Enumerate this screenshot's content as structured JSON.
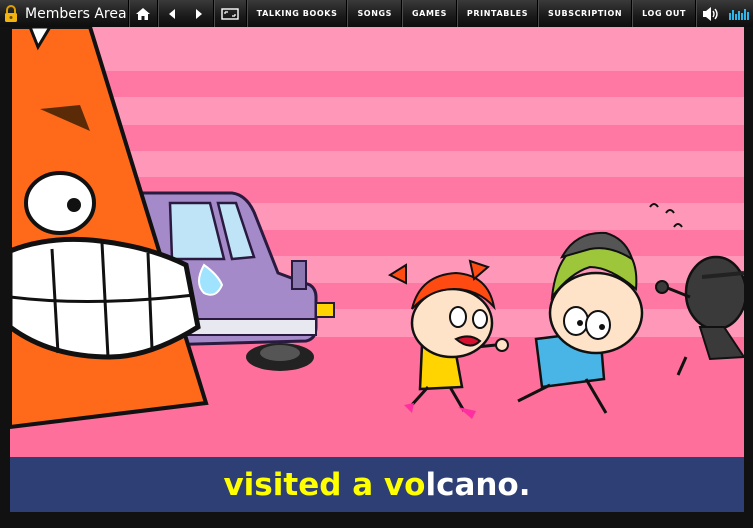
{
  "header": {
    "title": "Members Area",
    "nav": [
      "TALKING BOOKS",
      "SONGS",
      "GAMES",
      "PRINTABLES",
      "SUBSCRIPTION",
      "LOG OUT"
    ]
  },
  "icons": {
    "lock": "lock-icon",
    "home": "home-icon",
    "back": "previous-icon",
    "forward": "next-icon",
    "fullscreen": "fullscreen-icon",
    "volume": "volume-icon",
    "equalizer": "equalizer-icon"
  },
  "caption": {
    "read_part": "visited a vo",
    "unread_part": "lcano."
  },
  "colors": {
    "stage_bg": "#ff97b8",
    "stripe": "#ff6f9c",
    "caption_bg": "#2d3f74",
    "caption_highlight": "#ffff00"
  }
}
